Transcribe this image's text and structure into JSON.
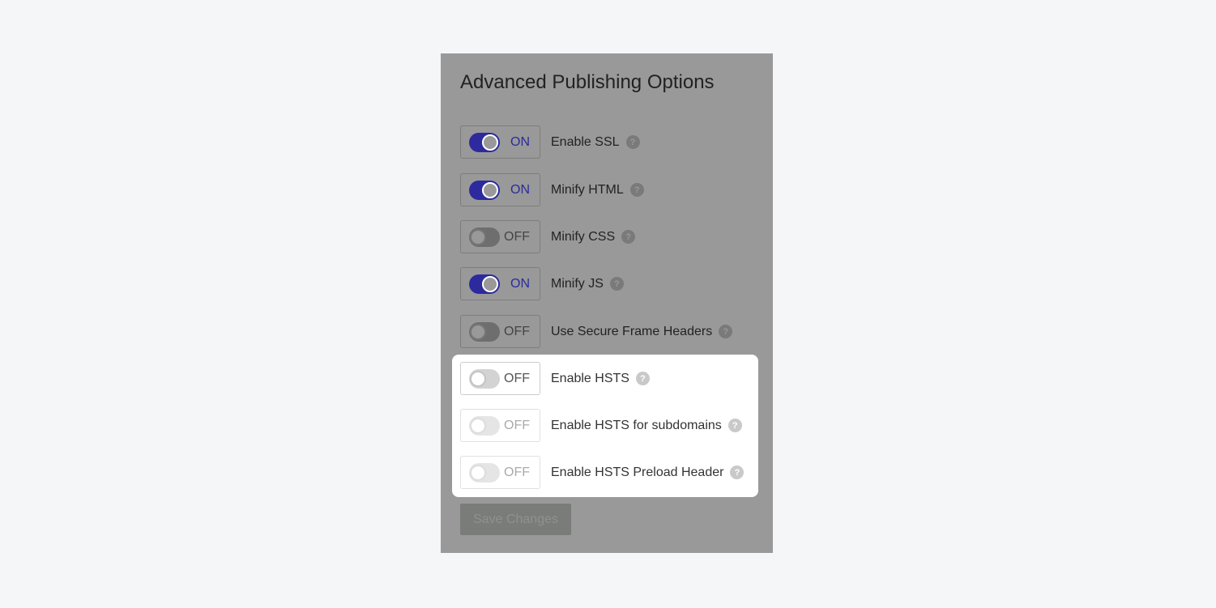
{
  "panel": {
    "title": "Advanced Publishing Options",
    "options": [
      {
        "label": "Enable SSL",
        "state": "ON"
      },
      {
        "label": "Minify HTML",
        "state": "ON"
      },
      {
        "label": "Minify CSS",
        "state": "OFF"
      },
      {
        "label": "Minify JS",
        "state": "ON"
      },
      {
        "label": "Use Secure Frame Headers",
        "state": "OFF"
      },
      {
        "label": "Enable HSTS",
        "state": "OFF"
      },
      {
        "label": "Enable HSTS for subdomains",
        "state": "OFF"
      },
      {
        "label": "Enable HSTS Preload Header",
        "state": "OFF"
      }
    ],
    "help_glyph": "?",
    "save_label": "Save Changes"
  },
  "colors": {
    "accent": "#2d2a9e",
    "overlay": "#999999",
    "background": "#f5f6f8"
  }
}
